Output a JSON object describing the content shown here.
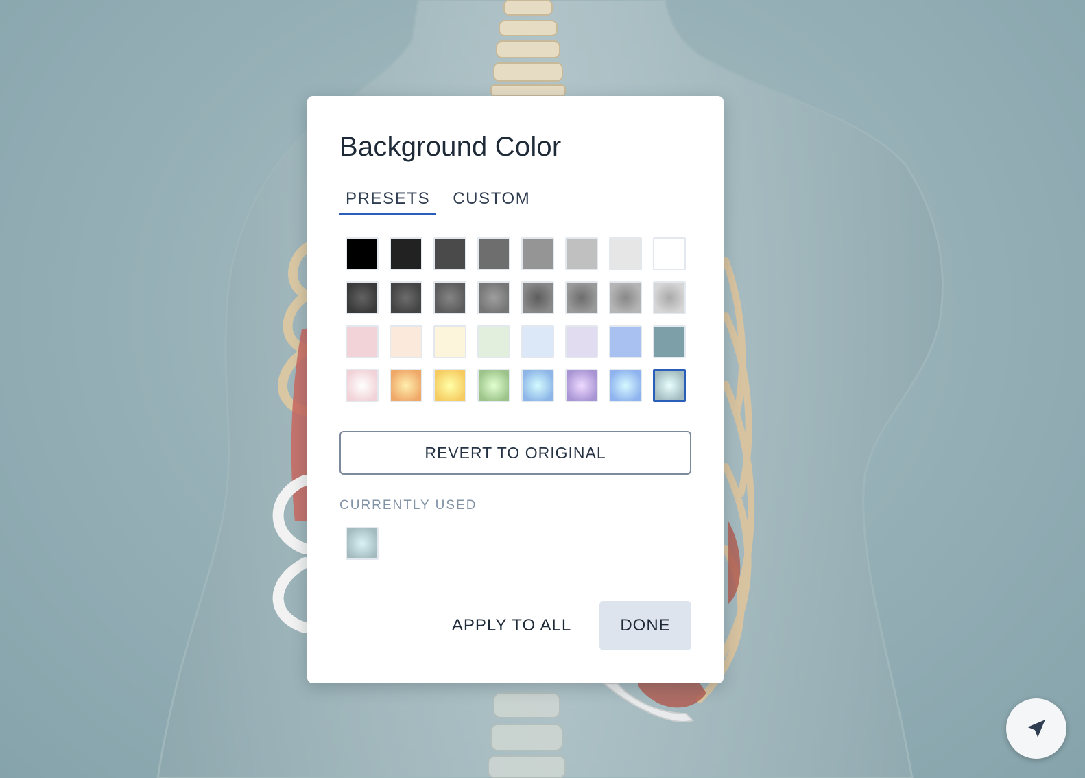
{
  "dialog": {
    "title": "Background Color",
    "tabs": [
      {
        "label": "PRESETS",
        "active": true
      },
      {
        "label": "CUSTOM",
        "active": false
      }
    ],
    "presets": {
      "rows": [
        [
          "#000000",
          "#222222",
          "#4a4a4a",
          "#6e6e6e",
          "#959595",
          "#c0c0c0",
          "#e6e6e6",
          "#ffffff"
        ],
        [
          "#3a3a3a",
          "#444444",
          "#5c5c5c",
          "#767676",
          "#8a8a8a",
          "#9a9a9a",
          "#b5b5b5",
          "#d6d6d6"
        ],
        [
          "#f2d3d8",
          "#fbeadb",
          "#fdf4dc",
          "#e2efdc",
          "#dce8f7",
          "#e1dcf0",
          "#a9c1f0",
          "#7da0a8"
        ],
        [
          "#f1d2d7",
          "#efa868",
          "#f6cc62",
          "#9cc38a",
          "#8db5e7",
          "#a894d3",
          "#8fb3ee",
          "#a3bbbf"
        ]
      ],
      "gradient_rows": [
        1,
        3
      ],
      "selected": {
        "row": 3,
        "col": 7
      }
    },
    "revert_label": "REVERT TO ORIGINAL",
    "currently_used_label": "CURRENTLY USED",
    "currently_used_color": "#a3bbbf",
    "apply_label": "APPLY TO ALL",
    "done_label": "DONE"
  },
  "colors": {
    "accent": "#2b5eb8",
    "scene_background": "#95afb6"
  },
  "nav_button_icon": "navigation-arrow-icon"
}
